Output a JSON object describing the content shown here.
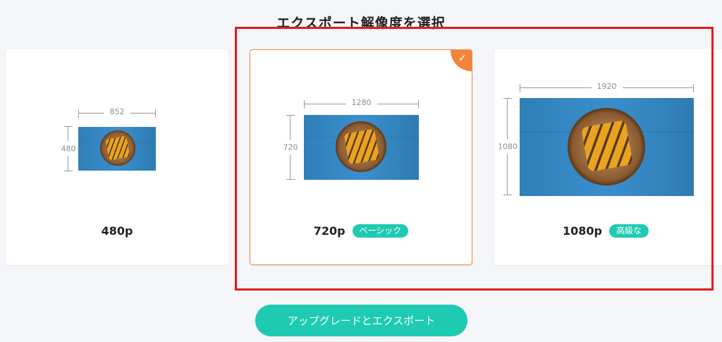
{
  "page_title": "エクスポート解像度を選択",
  "options": [
    {
      "resolution": "480p",
      "width_label": "852",
      "height_label": "480",
      "badge": ""
    },
    {
      "resolution": "720p",
      "width_label": "1280",
      "height_label": "720",
      "badge": "ベーシック"
    },
    {
      "resolution": "1080p",
      "width_label": "1920",
      "height_label": "1080",
      "badge": "高級な"
    }
  ],
  "selected_resolution": "720p",
  "cta_label": "アップグレードとエクスポート",
  "colors": {
    "accent_teal": "#1ecbb2",
    "selected_orange": "#f2843c",
    "annotation_red": "#e51a1a"
  },
  "icons": {
    "selected_check": "check-icon"
  }
}
